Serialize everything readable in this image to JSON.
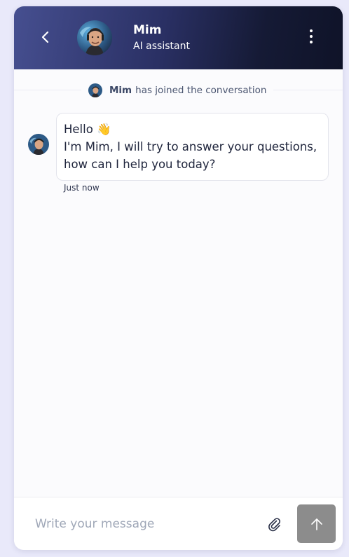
{
  "header": {
    "bot_name": "Mim",
    "bot_role": "AI assistant",
    "back_icon": "chevron-left-icon",
    "menu_icon": "kebab-menu-icon"
  },
  "conversation": {
    "join_notice": {
      "name": "Mim",
      "text": "has joined the conversation"
    },
    "messages": [
      {
        "sender": "Mim",
        "lines": [
          "Hello 👋",
          "I'm Mim, I will try to answer your questions,",
          "how can I help you today?"
        ],
        "timestamp": "Just now"
      }
    ]
  },
  "composer": {
    "placeholder": "Write your message",
    "value": "",
    "attach_icon": "paperclip-icon",
    "send_icon": "arrow-up-icon"
  },
  "colors": {
    "header_gradient_start": "#464f90",
    "header_gradient_end": "#0f1328",
    "send_button": "#8c8c8c",
    "page_background": "#e9e9fa"
  }
}
